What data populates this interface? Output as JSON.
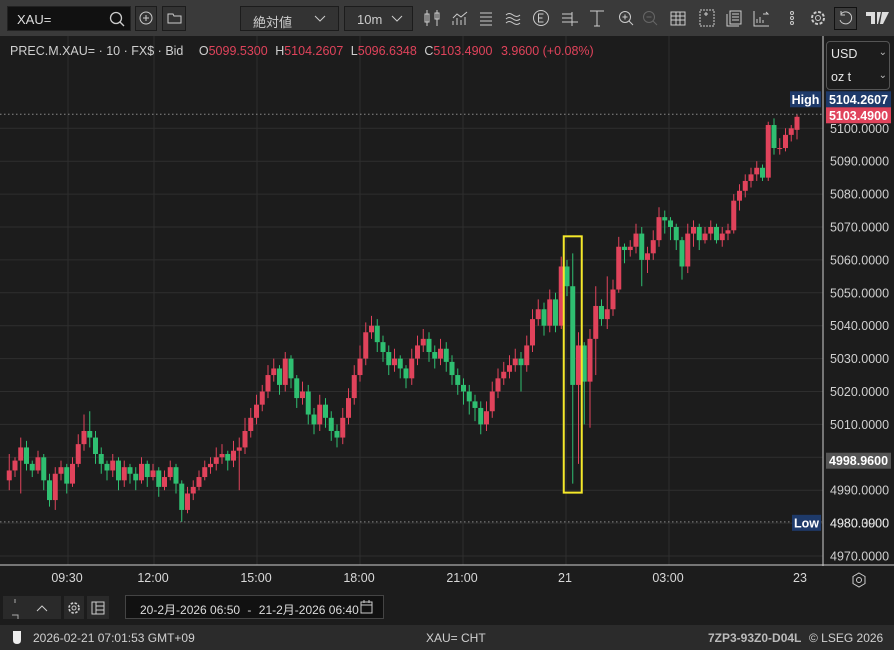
{
  "toolbar": {
    "search_value": "XAU=",
    "scale_mode": "絶対値",
    "interval": "10m",
    "icons": [
      "search-icon",
      "add-icon",
      "folder-icon",
      "candlestick-icon",
      "indicator-icon",
      "lines-icon",
      "waves-icon",
      "event-icon",
      "crosshair-icon",
      "text-icon",
      "zoom-in-icon",
      "zoom-out-icon",
      "table-icon",
      "add-panel-icon",
      "news-icon",
      "chart-export-icon",
      "more-icon",
      "gear-icon",
      "reset-icon",
      "tradingview-logo"
    ]
  },
  "legend": {
    "instrument": "PREC.M.XAU=",
    "interval": "10",
    "currency": "FX$",
    "side": "Bid",
    "open_label": "O",
    "open": "5099.5300",
    "high_label": "H",
    "high": "5104.2607",
    "low_label": "L",
    "low": "5096.6348",
    "close_label": "C",
    "close": "5103.4900",
    "change": "3.9600 (+0.08%)"
  },
  "units": {
    "currency": "USD",
    "unit": "oz t"
  },
  "markers": {
    "high_label": "High",
    "high_value": "5104.2607",
    "last_value": "5103.4900",
    "cursor_value": "4998.9600",
    "low_label": "Low",
    "low_value": "4980.3900"
  },
  "chart_data": {
    "type": "candlestick",
    "ylim": [
      4965,
      5112
    ],
    "yticks": [
      "4970.0000",
      "4980.0000",
      "4990.0000",
      "5000.0000",
      "5010.0000",
      "5020.0000",
      "5030.0000",
      "5040.0000",
      "5050.0000",
      "5060.0000",
      "5070.0000",
      "5080.0000",
      "5090.0000",
      "5100.0000"
    ],
    "ytick_values": [
      4970,
      4980,
      4990,
      5000,
      5010,
      5020,
      5030,
      5040,
      5050,
      5060,
      5070,
      5080,
      5090,
      5100
    ],
    "xticks": [
      "09:30",
      "12:00",
      "15:00",
      "18:00",
      "21:00",
      "21",
      "03:00",
      "23"
    ],
    "grid": true,
    "colors": {
      "up": "#e0435b",
      "down": "#2fbf71",
      "highlight": "#f5e82a",
      "marker": "#1e3a6a",
      "last": "#e0435b"
    },
    "highlight_candle_index": 98,
    "ohlc": [
      [
        4993,
        5001,
        4990,
        4996
      ],
      [
        4996,
        5000,
        4994,
        4999
      ],
      [
        4999,
        5006,
        4989,
        5003
      ],
      [
        5003,
        5005,
        4996,
        4998
      ],
      [
        4998,
        4999,
        4994,
        4996
      ],
      [
        4996,
        5002,
        4995,
        5000
      ],
      [
        5000,
        5001,
        4990,
        4993
      ],
      [
        4993,
        4995,
        4985,
        4987
      ],
      [
        4987,
        4997,
        4984,
        4995
      ],
      [
        4995,
        4999,
        4993,
        4997
      ],
      [
        4997,
        4998,
        4989,
        4992
      ],
      [
        4992,
        5000,
        4991,
        4998
      ],
      [
        4998,
        5007,
        4997,
        5004
      ],
      [
        5004,
        5013,
        5002,
        5008
      ],
      [
        5008,
        5014,
        5003,
        5006
      ],
      [
        5006,
        5008,
        4998,
        5001
      ],
      [
        5001,
        5003,
        4995,
        4998
      ],
      [
        4998,
        4999,
        4993,
        4996
      ],
      [
        4996,
        5001,
        4994,
        4999
      ],
      [
        4999,
        5000,
        4990,
        4993
      ],
      [
        4993,
        4999,
        4991,
        4997
      ],
      [
        4997,
        4998,
        4992,
        4995
      ],
      [
        4995,
        4997,
        4990,
        4993
      ],
      [
        4993,
        5000,
        4992,
        4998
      ],
      [
        4998,
        4999,
        4991,
        4994
      ],
      [
        4994,
        4998,
        4993,
        4996
      ],
      [
        4996,
        4997,
        4988,
        4991
      ],
      [
        4991,
        4996,
        4990,
        4994
      ],
      [
        4994,
        4999,
        4993,
        4997
      ],
      [
        4997,
        4998,
        4989,
        4992
      ],
      [
        4992,
        4993,
        4980.39,
        4984
      ],
      [
        4984,
        4991,
        4983,
        4989
      ],
      [
        4989,
        4993,
        4987,
        4991
      ],
      [
        4991,
        4996,
        4990,
        4994
      ],
      [
        4994,
        4999,
        4993,
        4997
      ],
      [
        4997,
        5000,
        4995,
        4998
      ],
      [
        4998,
        5003,
        4996,
        5000
      ],
      [
        5000,
        5004,
        4998,
        5001
      ],
      [
        5001,
        5002,
        4996,
        4999
      ],
      [
        4999,
        5005,
        4997,
        5002
      ],
      [
        5002,
        5006,
        4990,
        5003
      ],
      [
        5003,
        5012,
        5001,
        5008
      ],
      [
        5008,
        5015,
        5006,
        5012
      ],
      [
        5012,
        5019,
        5010,
        5016
      ],
      [
        5016,
        5022,
        5014,
        5020
      ],
      [
        5020,
        5028,
        5018,
        5025
      ],
      [
        5025,
        5030,
        5023,
        5027
      ],
      [
        5027,
        5028,
        5019,
        5022
      ],
      [
        5022,
        5032,
        5020,
        5030
      ],
      [
        5030,
        5031,
        5021,
        5024
      ],
      [
        5024,
        5025,
        5015,
        5018
      ],
      [
        5018,
        5023,
        5016,
        5020
      ],
      [
        5020,
        5022,
        5010,
        5013
      ],
      [
        5013,
        5015,
        5007,
        5010
      ],
      [
        5010,
        5019,
        5008,
        5016
      ],
      [
        5016,
        5018,
        5009,
        5012
      ],
      [
        5012,
        5014,
        5005,
        5008
      ],
      [
        5008,
        5010,
        5003,
        5006
      ],
      [
        5006,
        5015,
        5004,
        5012
      ],
      [
        5012,
        5021,
        5010,
        5018
      ],
      [
        5018,
        5028,
        5016,
        5025
      ],
      [
        5025,
        5034,
        5023,
        5030
      ],
      [
        5030,
        5041,
        5028,
        5038
      ],
      [
        5038,
        5043,
        5036,
        5040
      ],
      [
        5040,
        5042,
        5032,
        5035
      ],
      [
        5035,
        5037,
        5029,
        5032
      ],
      [
        5032,
        5034,
        5025,
        5028
      ],
      [
        5028,
        5033,
        5026,
        5030
      ],
      [
        5030,
        5031,
        5024,
        5027
      ],
      [
        5027,
        5028,
        5021,
        5024
      ],
      [
        5024,
        5033,
        5022,
        5030
      ],
      [
        5030,
        5037,
        5028,
        5034
      ],
      [
        5034,
        5039,
        5032,
        5036
      ],
      [
        5036,
        5038,
        5029,
        5032
      ],
      [
        5032,
        5034,
        5027,
        5030
      ],
      [
        5030,
        5036,
        5028,
        5033
      ],
      [
        5033,
        5035,
        5026,
        5029
      ],
      [
        5029,
        5031,
        5022,
        5025
      ],
      [
        5025,
        5027,
        5019,
        5022
      ],
      [
        5022,
        5024,
        5016,
        5020
      ],
      [
        5020,
        5022,
        5013,
        5017
      ],
      [
        5017,
        5019,
        5011,
        5015
      ],
      [
        5015,
        5017,
        5007,
        5010
      ],
      [
        5010,
        5017,
        5008,
        5014
      ],
      [
        5014,
        5023,
        5012,
        5020
      ],
      [
        5020,
        5027,
        5018,
        5024
      ],
      [
        5024,
        5029,
        5022,
        5026
      ],
      [
        5026,
        5031,
        5024,
        5028
      ],
      [
        5028,
        5033,
        5026,
        5030
      ],
      [
        5030,
        5032,
        5020,
        5028
      ],
      [
        5028,
        5037,
        5026,
        5034
      ],
      [
        5034,
        5045,
        5032,
        5042
      ],
      [
        5042,
        5048,
        5040,
        5045
      ],
      [
        5045,
        5047,
        5037,
        5040
      ],
      [
        5040,
        5051,
        5038,
        5048
      ],
      [
        5048,
        5050,
        5038,
        5040
      ],
      [
        5040,
        5061,
        5039,
        5058
      ],
      [
        5058,
        5060,
        5049,
        5052
      ],
      [
        5052,
        5062,
        4992,
        5022
      ],
      [
        5022,
        5038,
        4998,
        5034
      ],
      [
        5034,
        5035,
        5010,
        5023
      ],
      [
        5023,
        5039,
        5009,
        5036
      ],
      [
        5036,
        5052,
        5025,
        5046
      ],
      [
        5046,
        5048,
        5040,
        5042
      ],
      [
        5042,
        5055,
        5039,
        5045
      ],
      [
        5045,
        5054,
        5043,
        5051
      ],
      [
        5051,
        5067,
        5050,
        5064
      ],
      [
        5064,
        5065,
        5059,
        5063
      ],
      [
        5063,
        5066,
        5061,
        5064
      ],
      [
        5064,
        5071,
        5062,
        5068
      ],
      [
        5068,
        5070,
        5052,
        5060
      ],
      [
        5060,
        5064,
        5056,
        5062
      ],
      [
        5062,
        5069,
        5060,
        5066
      ],
      [
        5066,
        5076,
        5064,
        5073
      ],
      [
        5073,
        5075,
        5068,
        5072
      ],
      [
        5072,
        5073,
        5066,
        5070
      ],
      [
        5070,
        5071,
        5063,
        5066
      ],
      [
        5066,
        5067,
        5054,
        5058
      ],
      [
        5058,
        5071,
        5056,
        5068
      ],
      [
        5068,
        5072,
        5064,
        5070
      ],
      [
        5070,
        5071,
        5063,
        5066
      ],
      [
        5066,
        5070,
        5065,
        5068
      ],
      [
        5068,
        5072,
        5066,
        5070
      ],
      [
        5070,
        5071,
        5065,
        5066
      ],
      [
        5066,
        5070,
        5064,
        5068
      ],
      [
        5068,
        5071,
        5066,
        5069
      ],
      [
        5069,
        5080,
        5068,
        5078
      ],
      [
        5078,
        5083,
        5075,
        5081
      ],
      [
        5081,
        5086,
        5079,
        5084
      ],
      [
        5084,
        5088,
        5082,
        5086
      ],
      [
        5086,
        5090,
        5084,
        5088
      ],
      [
        5088,
        5089,
        5084,
        5085
      ],
      [
        5085,
        5102,
        5084,
        5101
      ],
      [
        5101,
        5103,
        5092,
        5094
      ],
      [
        5094,
        5097,
        5092,
        5094
      ],
      [
        5094,
        5100,
        5093,
        5098
      ],
      [
        5098,
        5101,
        5096,
        5100
      ],
      [
        5099.53,
        5104.2607,
        5096.6348,
        5103.49
      ]
    ]
  },
  "footer": {
    "date_range_start": "20-2月-2026 06:50",
    "date_range_sep": "-",
    "date_range_end": "21-2月-2026 06:40",
    "timestamp": "2026-02-21 07:01:53 GMT+09",
    "ric": "XAU= CHT",
    "code": "7ZP3-93Z0-D04L",
    "copyright": "© LSEG 2026"
  }
}
